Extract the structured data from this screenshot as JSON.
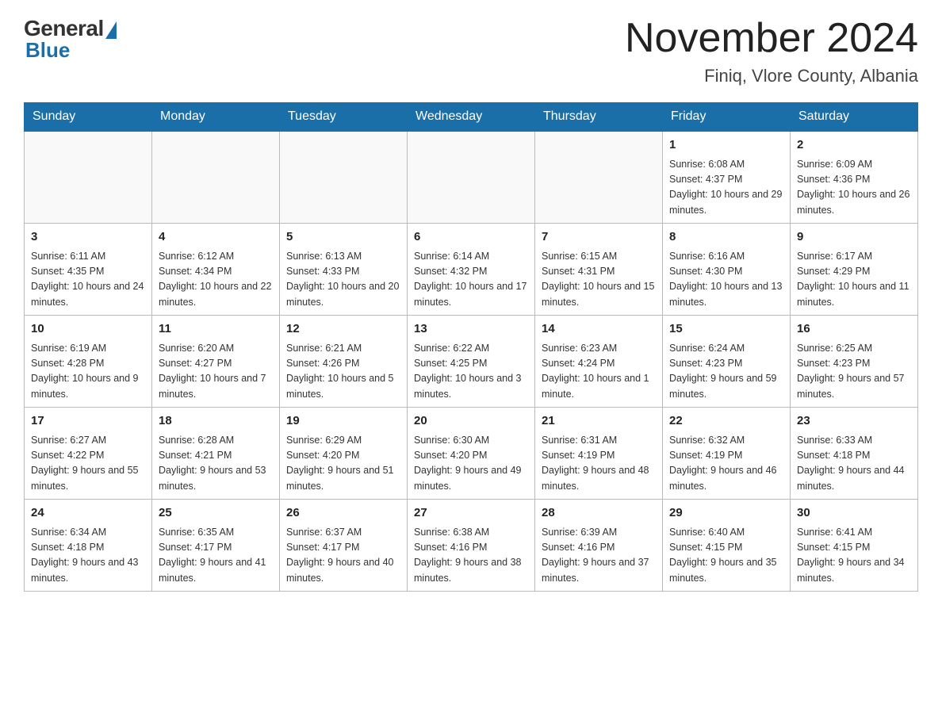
{
  "logo": {
    "general": "General",
    "blue": "Blue"
  },
  "header": {
    "title": "November 2024",
    "subtitle": "Finiq, Vlore County, Albania"
  },
  "days_of_week": [
    "Sunday",
    "Monday",
    "Tuesday",
    "Wednesday",
    "Thursday",
    "Friday",
    "Saturday"
  ],
  "weeks": [
    [
      {
        "day": "",
        "info": ""
      },
      {
        "day": "",
        "info": ""
      },
      {
        "day": "",
        "info": ""
      },
      {
        "day": "",
        "info": ""
      },
      {
        "day": "",
        "info": ""
      },
      {
        "day": "1",
        "info": "Sunrise: 6:08 AM\nSunset: 4:37 PM\nDaylight: 10 hours and 29 minutes."
      },
      {
        "day": "2",
        "info": "Sunrise: 6:09 AM\nSunset: 4:36 PM\nDaylight: 10 hours and 26 minutes."
      }
    ],
    [
      {
        "day": "3",
        "info": "Sunrise: 6:11 AM\nSunset: 4:35 PM\nDaylight: 10 hours and 24 minutes."
      },
      {
        "day": "4",
        "info": "Sunrise: 6:12 AM\nSunset: 4:34 PM\nDaylight: 10 hours and 22 minutes."
      },
      {
        "day": "5",
        "info": "Sunrise: 6:13 AM\nSunset: 4:33 PM\nDaylight: 10 hours and 20 minutes."
      },
      {
        "day": "6",
        "info": "Sunrise: 6:14 AM\nSunset: 4:32 PM\nDaylight: 10 hours and 17 minutes."
      },
      {
        "day": "7",
        "info": "Sunrise: 6:15 AM\nSunset: 4:31 PM\nDaylight: 10 hours and 15 minutes."
      },
      {
        "day": "8",
        "info": "Sunrise: 6:16 AM\nSunset: 4:30 PM\nDaylight: 10 hours and 13 minutes."
      },
      {
        "day": "9",
        "info": "Sunrise: 6:17 AM\nSunset: 4:29 PM\nDaylight: 10 hours and 11 minutes."
      }
    ],
    [
      {
        "day": "10",
        "info": "Sunrise: 6:19 AM\nSunset: 4:28 PM\nDaylight: 10 hours and 9 minutes."
      },
      {
        "day": "11",
        "info": "Sunrise: 6:20 AM\nSunset: 4:27 PM\nDaylight: 10 hours and 7 minutes."
      },
      {
        "day": "12",
        "info": "Sunrise: 6:21 AM\nSunset: 4:26 PM\nDaylight: 10 hours and 5 minutes."
      },
      {
        "day": "13",
        "info": "Sunrise: 6:22 AM\nSunset: 4:25 PM\nDaylight: 10 hours and 3 minutes."
      },
      {
        "day": "14",
        "info": "Sunrise: 6:23 AM\nSunset: 4:24 PM\nDaylight: 10 hours and 1 minute."
      },
      {
        "day": "15",
        "info": "Sunrise: 6:24 AM\nSunset: 4:23 PM\nDaylight: 9 hours and 59 minutes."
      },
      {
        "day": "16",
        "info": "Sunrise: 6:25 AM\nSunset: 4:23 PM\nDaylight: 9 hours and 57 minutes."
      }
    ],
    [
      {
        "day": "17",
        "info": "Sunrise: 6:27 AM\nSunset: 4:22 PM\nDaylight: 9 hours and 55 minutes."
      },
      {
        "day": "18",
        "info": "Sunrise: 6:28 AM\nSunset: 4:21 PM\nDaylight: 9 hours and 53 minutes."
      },
      {
        "day": "19",
        "info": "Sunrise: 6:29 AM\nSunset: 4:20 PM\nDaylight: 9 hours and 51 minutes."
      },
      {
        "day": "20",
        "info": "Sunrise: 6:30 AM\nSunset: 4:20 PM\nDaylight: 9 hours and 49 minutes."
      },
      {
        "day": "21",
        "info": "Sunrise: 6:31 AM\nSunset: 4:19 PM\nDaylight: 9 hours and 48 minutes."
      },
      {
        "day": "22",
        "info": "Sunrise: 6:32 AM\nSunset: 4:19 PM\nDaylight: 9 hours and 46 minutes."
      },
      {
        "day": "23",
        "info": "Sunrise: 6:33 AM\nSunset: 4:18 PM\nDaylight: 9 hours and 44 minutes."
      }
    ],
    [
      {
        "day": "24",
        "info": "Sunrise: 6:34 AM\nSunset: 4:18 PM\nDaylight: 9 hours and 43 minutes."
      },
      {
        "day": "25",
        "info": "Sunrise: 6:35 AM\nSunset: 4:17 PM\nDaylight: 9 hours and 41 minutes."
      },
      {
        "day": "26",
        "info": "Sunrise: 6:37 AM\nSunset: 4:17 PM\nDaylight: 9 hours and 40 minutes."
      },
      {
        "day": "27",
        "info": "Sunrise: 6:38 AM\nSunset: 4:16 PM\nDaylight: 9 hours and 38 minutes."
      },
      {
        "day": "28",
        "info": "Sunrise: 6:39 AM\nSunset: 4:16 PM\nDaylight: 9 hours and 37 minutes."
      },
      {
        "day": "29",
        "info": "Sunrise: 6:40 AM\nSunset: 4:15 PM\nDaylight: 9 hours and 35 minutes."
      },
      {
        "day": "30",
        "info": "Sunrise: 6:41 AM\nSunset: 4:15 PM\nDaylight: 9 hours and 34 minutes."
      }
    ]
  ]
}
